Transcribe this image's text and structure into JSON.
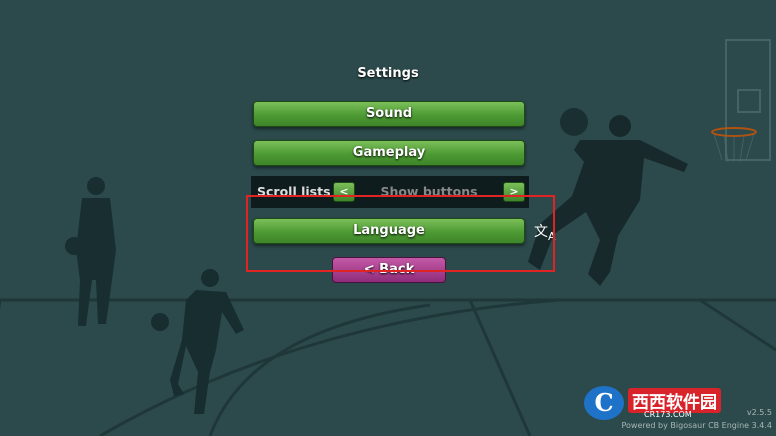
{
  "menu": {
    "title": "Settings",
    "sound_label": "Sound",
    "gameplay_label": "Gameplay",
    "scroll_lists_label": "Scroll lists",
    "scroll_prev": "<",
    "scroll_value": "Show buttons",
    "scroll_next": ">",
    "language_label": "Language",
    "back_label": "< Back"
  },
  "language_icon": {
    "glyph": "文",
    "letter": "A"
  },
  "watermark": {
    "logo": "C",
    "text": "西西软件园",
    "url": "CR173.COM"
  },
  "footer": {
    "version": "v2.5.5",
    "powered_by": "Powered by Bigosaur CB Engine 3.4.4"
  },
  "colors": {
    "background": "#2c4a4c",
    "button_green": "#4d9a33",
    "back_button": "#a63a8e",
    "highlight": "#e02424"
  }
}
